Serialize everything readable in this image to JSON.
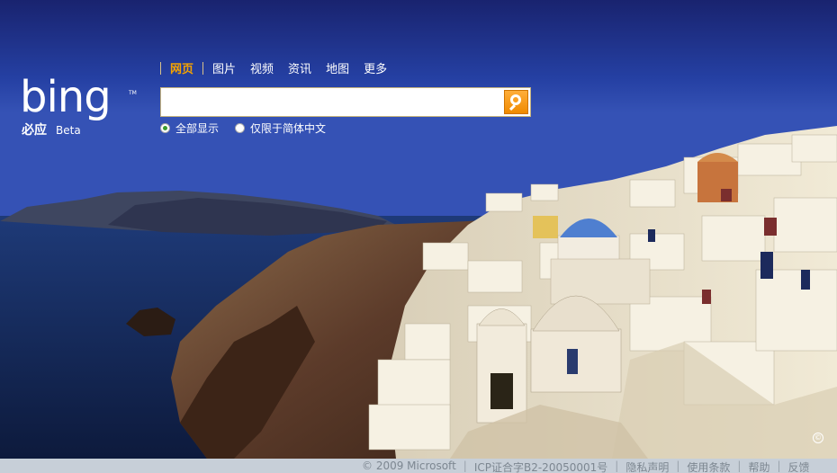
{
  "nav": {
    "items": [
      {
        "label": "网页",
        "active": true
      },
      {
        "label": "图片"
      },
      {
        "label": "视频"
      },
      {
        "label": "资讯"
      },
      {
        "label": "地图"
      },
      {
        "label": "更多"
      }
    ]
  },
  "logo": {
    "text": "bing",
    "tm": "TM",
    "cn": "必应",
    "beta": "Beta"
  },
  "search": {
    "value": "",
    "button_icon": "search-icon"
  },
  "radios": [
    {
      "label": "全部显示",
      "checked": true
    },
    {
      "label": "仅限于简体中文",
      "checked": false
    }
  ],
  "footer": {
    "copyright": "© 2009 Microsoft",
    "icp": "ICP证合字B2-20050001号",
    "privacy": "隐私声明",
    "terms": "使用条款",
    "help": "帮助",
    "feedback": "反馈"
  },
  "colors": {
    "accent": "#f5a300",
    "sky": "#24399a",
    "footer": "#c7cfd8"
  },
  "photo_icon": "©"
}
